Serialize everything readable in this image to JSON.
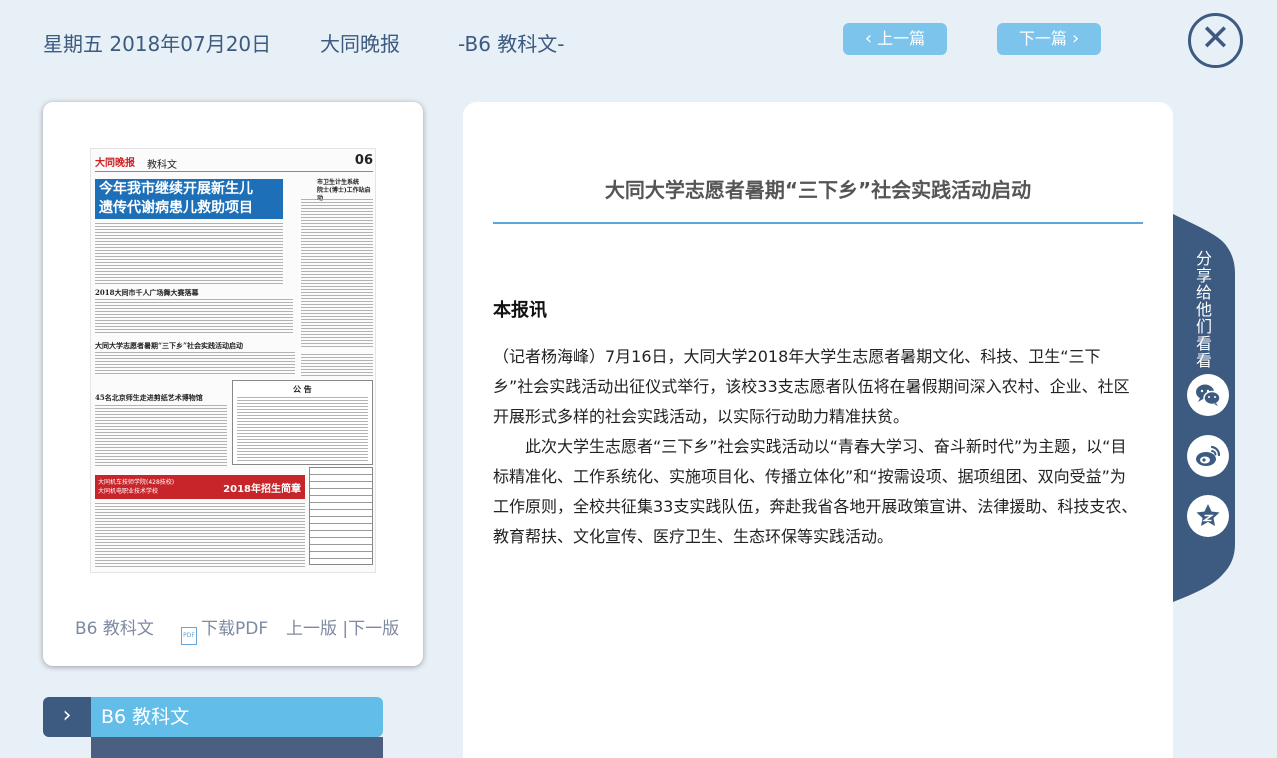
{
  "header": {
    "date": "星期五 2018年07月20日",
    "paper": "大同晚报",
    "section": "-B6 教科文-",
    "prev_label": "上一篇",
    "next_label": "下一篇"
  },
  "paper_thumb": {
    "masthead": "大同晚报",
    "column": "教科文",
    "page_no": "06",
    "headline": "今年我市继续开展新生儿\n遗传代谢病患儿救助项目",
    "side_title": "市卫生计生系统\n院士(博士)工作站启动",
    "sub1": "2018大同市千人广场舞大赛落幕",
    "sub2": "大同大学志愿者暑期“三下乡”社会实践活动启动",
    "sub3": "45名北京师生走进剪纸艺术博物馆",
    "notice": "公  告",
    "ad_left": "大同机车技师学院(428技校)\n大同机电职业技术学校",
    "ad_right": "2018年招生简章"
  },
  "card_footer": {
    "section": "B6 教科文",
    "pdf_icon_text": "PDF",
    "pdf_label": "下载PDF",
    "prev_next": "上一版 |下一版"
  },
  "section_tab": {
    "label": "B6  教科文"
  },
  "article": {
    "title": "大同大学志愿者暑期“三下乡”社会实践活动启动",
    "subtitle": "本报讯",
    "paragraphs": [
      "（记者杨海峰）7月16日，大同大学2018年大学生志愿者暑期文化、科技、卫生“三下乡”社会实践活动出征仪式举行，该校33支志愿者队伍将在暑假期间深入农村、企业、社区开展形式多样的社会实践活动，以实际行动助力精准扶贫。",
      "此次大学生志愿者“三下乡”社会实践活动以“青春大学习、奋斗新时代”为主题，以“目标精准化、工作系统化、实施项目化、传播立体化”和“按需设项、据项组团、双向受益”为工作原则，全校共征集33支实践队伍，奔赴我省各地开展政策宣讲、法律援助、科技支农、教育帮扶、文化宣传、医疗卫生、生态环保等实践活动。"
    ]
  },
  "share": {
    "label": "分享给他们看看",
    "buttons": [
      "wechat-icon",
      "weibo-icon",
      "favorite-icon"
    ]
  },
  "colors": {
    "background": "#e8f0f7",
    "accent_blue": "#7cc4ec",
    "navy": "#3d5a80",
    "rule": "#5ba8d8"
  }
}
